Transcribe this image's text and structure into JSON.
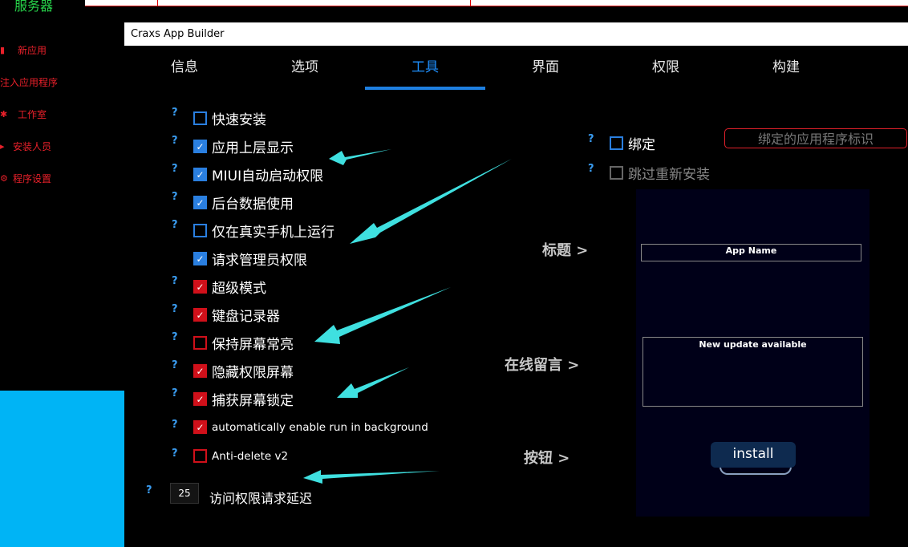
{
  "background_app": {
    "title": "服务器",
    "sidebar": [
      {
        "label": "新应用",
        "icon": "app-icon"
      },
      {
        "label": "注入应用程序",
        "icon": "inject-icon"
      },
      {
        "label": "工作室",
        "icon": "bluetooth-icon"
      },
      {
        "label": "安装人员",
        "icon": "installer-icon"
      },
      {
        "label": "程序设置",
        "icon": "settings-icon"
      }
    ]
  },
  "dialog": {
    "title": "Craxs App Builder",
    "tabs": [
      {
        "label": "信息",
        "active": false
      },
      {
        "label": "选项",
        "active": false
      },
      {
        "label": "工具",
        "active": true
      },
      {
        "label": "界面",
        "active": false
      },
      {
        "label": "权限",
        "active": false
      },
      {
        "label": "构建",
        "active": false
      }
    ],
    "help_mark": "?",
    "options": [
      {
        "label": "快速安装",
        "checked": false,
        "color": "blue",
        "help": true
      },
      {
        "label": "应用上层显示",
        "checked": true,
        "color": "blue",
        "help": true
      },
      {
        "label": "MIUI自动启动权限",
        "checked": true,
        "color": "blue",
        "help": true
      },
      {
        "label": "后台数据使用",
        "checked": true,
        "color": "blue",
        "help": true
      },
      {
        "label": "仅在真实手机上运行",
        "checked": false,
        "color": "blue",
        "help": true
      },
      {
        "label": "请求管理员权限",
        "checked": true,
        "color": "blue",
        "help": false
      },
      {
        "label": "超级模式",
        "checked": true,
        "color": "red",
        "help": true
      },
      {
        "label": "键盘记录器",
        "checked": true,
        "color": "red",
        "help": true
      },
      {
        "label": "保持屏幕常亮",
        "checked": false,
        "color": "red",
        "help": true
      },
      {
        "label": "隐藏权限屏幕",
        "checked": true,
        "color": "red",
        "help": true
      },
      {
        "label": "捕获屏幕锁定",
        "checked": true,
        "color": "red",
        "help": true
      },
      {
        "label": "automatically enable run in background",
        "checked": true,
        "color": "red",
        "help": true
      },
      {
        "label": "Anti-delete v2",
        "checked": false,
        "color": "red",
        "help": true
      }
    ],
    "delay": {
      "value": "25",
      "label": "访问权限请求延迟"
    },
    "bind": {
      "label": "绑定",
      "checked": false,
      "placeholder": "绑定的应用程序标识"
    },
    "skip_reinstall": {
      "label": "跳过重新安装",
      "checked": false,
      "disabled": true
    },
    "preview_labels": {
      "title": "标题 >",
      "message": "在线留言 >",
      "button": "按钮 >"
    },
    "preview": {
      "app_name": "App Name",
      "message": "New update available",
      "install_button": "install"
    },
    "colors": {
      "accent_blue": "#1e7fe0",
      "red": "#d0101a",
      "arrow": "#3fe0e0"
    }
  }
}
